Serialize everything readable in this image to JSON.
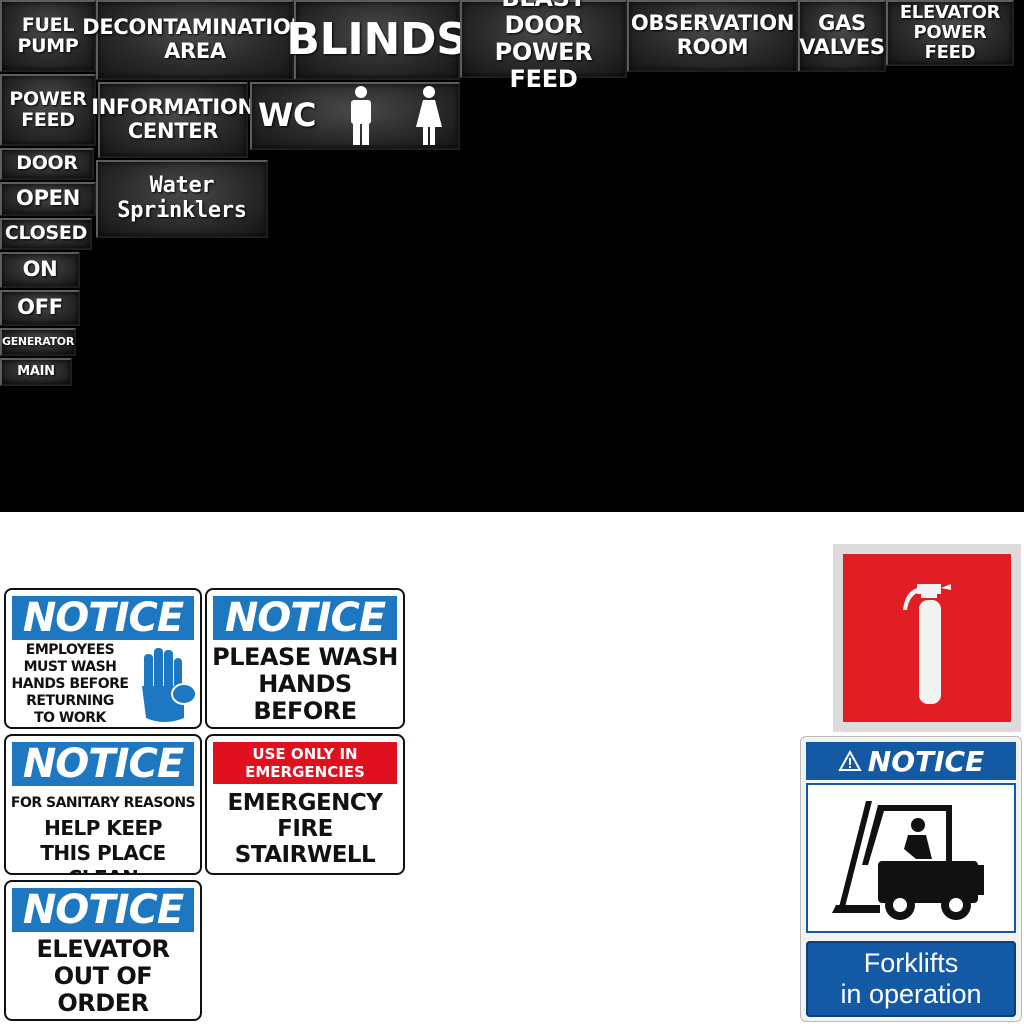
{
  "plates": {
    "fuel_pump": "FUEL\nPUMP",
    "decontamination": "DECONTAMINATION\nAREA",
    "blinds": "BLINDS",
    "blast_door": "BLAST DOOR\nPOWER FEED",
    "observation": "OBSERVATION\nROOM",
    "gas_valves": "GAS\nVALVES",
    "elevator_power": "ELEVATOR\nPOWER FEED",
    "power_feed": "POWER\nFEED",
    "information": "INFORMATION\nCENTER",
    "wc": "WC",
    "door": "DOOR",
    "open": "OPEN",
    "closed": "CLOSED",
    "on": "ON",
    "off": "OFF",
    "generator": "GENERATOR",
    "main": "MAIN",
    "water": "Water\nSprinklers"
  },
  "signs": {
    "notice_word": "NOTICE",
    "wash_employees": "EMPLOYEES\nMUST WASH\nHANDS BEFORE\nRETURNING\nTO WORK",
    "wash_leaving": "PLEASE WASH\nHANDS BEFORE\nLEAVING",
    "sanitary_line1": "FOR SANITARY REASONS",
    "sanitary_line2": "HELP KEEP\nTHIS PLACE CLEAN",
    "emergency_bar": "USE ONLY IN\nEMERGENCIES",
    "emergency_text": "EMERGENCY\nFIRE\nSTAIRWELL",
    "elevator_text": "ELEVATOR\nOUT OF\nORDER",
    "forklift_header": "NOTICE",
    "forklift_text": "Forklifts\nin operation"
  },
  "colors": {
    "notice_blue": "#1d78c1",
    "emergency_red": "#e1101f",
    "extinguisher_red": "#e01e24",
    "forklift_blue": "#1459a4"
  }
}
